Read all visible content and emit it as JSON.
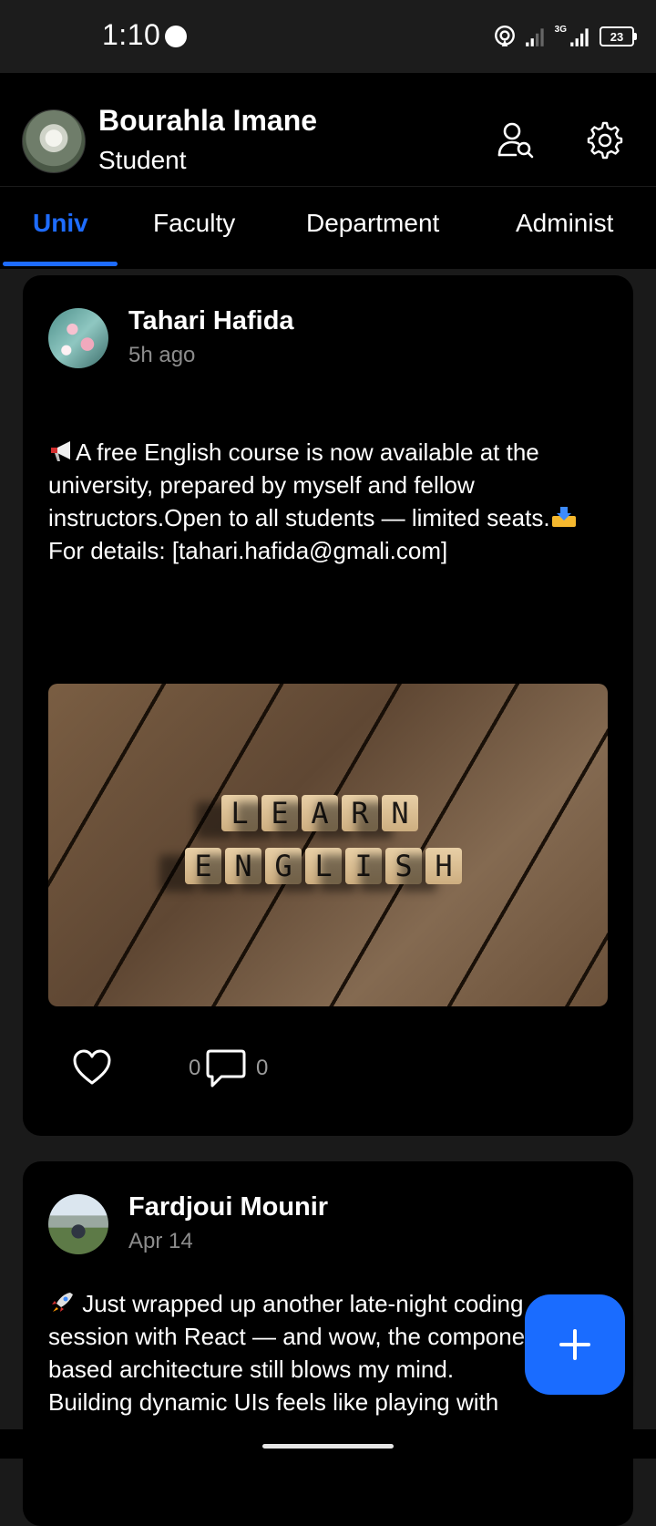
{
  "status_bar": {
    "time": "1:10",
    "network": "3G",
    "battery": "23"
  },
  "header": {
    "user_name": "Bourahla Imane",
    "user_role": "Student",
    "icons": [
      "find-user-icon",
      "gear-icon"
    ]
  },
  "tabs": [
    {
      "label": "Univ",
      "active": true
    },
    {
      "label": "Faculty",
      "active": false
    },
    {
      "label": "Department",
      "active": false
    },
    {
      "label": "Administ",
      "active": false
    }
  ],
  "accent_color": "#1e6cff",
  "posts": [
    {
      "author": "Tahari Hafida",
      "time": "5h ago",
      "text_1": "A free English course is now available at the university, prepared by myself and fellow instructors.Open to all students — limited seats.",
      "text_2": " For details: [tahari.hafida@gmali.com]",
      "image_words": [
        "LEARN",
        "ENGLISH"
      ],
      "likes": "0",
      "comments": "0"
    },
    {
      "author": "Fardjoui Mounir",
      "time": "Apr 14",
      "text": " Just wrapped up another late-night coding session with React — and wow, the component-based architecture still blows my mind.",
      "text_cut": "Building dynamic UIs feels like playing with"
    }
  ]
}
